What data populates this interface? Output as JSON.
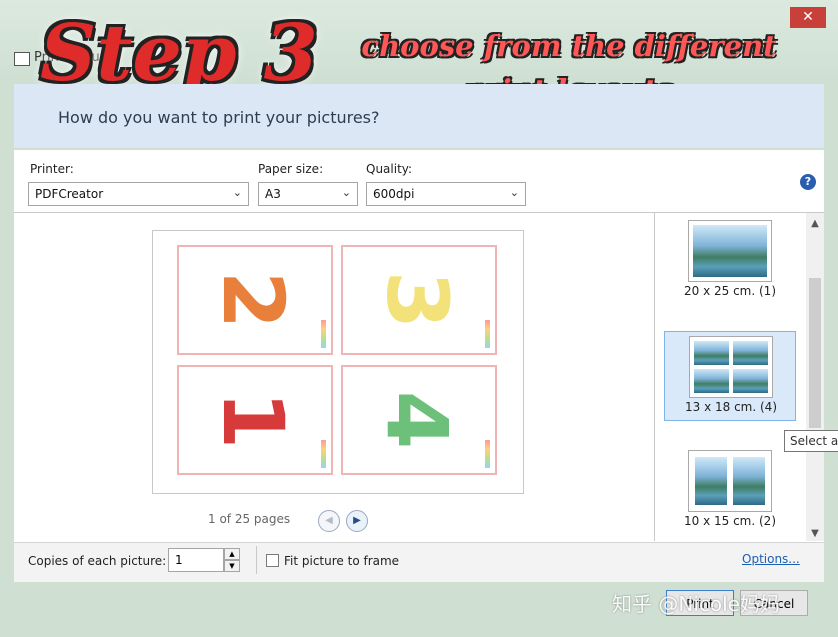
{
  "window": {
    "title": "Print Pictures",
    "close_glyph": "✕"
  },
  "overlay": {
    "step_title": "Step 3",
    "caption_line1": "choose from the different",
    "caption_line2": "print layouts"
  },
  "header": {
    "question": "How do you want to print your pictures?"
  },
  "settings": {
    "printer_label": "Printer:",
    "printer_value": "PDFCreator",
    "paper_label": "Paper size:",
    "paper_value": "A3",
    "quality_label": "Quality:",
    "quality_value": "600dpi",
    "help_glyph": "?"
  },
  "preview": {
    "cards": [
      {
        "number": "2",
        "color": "#e8803c"
      },
      {
        "number": "3",
        "color": "#f3e27a"
      },
      {
        "number": "1",
        "color": "#d63a3a"
      },
      {
        "number": "4",
        "color": "#6cc07a"
      }
    ],
    "pager": "1 of 25 pages",
    "prev_glyph": "◀",
    "next_glyph": "▶"
  },
  "layouts": [
    {
      "label": "20 x 25 cm. (1)",
      "selected": false
    },
    {
      "label": "13 x 18 cm. (4)",
      "selected": true
    },
    {
      "label": "10 x 15 cm. (2)",
      "selected": false
    }
  ],
  "tooltip": "Select a",
  "footer": {
    "copies_label": "Copies of each picture:",
    "copies_value": "1",
    "spin_up": "▲",
    "spin_down": "▼",
    "fit_label": "Fit picture to frame",
    "options_link": "Options..."
  },
  "buttons": {
    "print": "Print",
    "cancel": "Cancel"
  },
  "watermark": "知乎 @Nicole妈妈",
  "colors": {
    "accent": "#2a5db0",
    "selected_bg": "#d9e9fa",
    "card_border": "#f0b4b4"
  }
}
